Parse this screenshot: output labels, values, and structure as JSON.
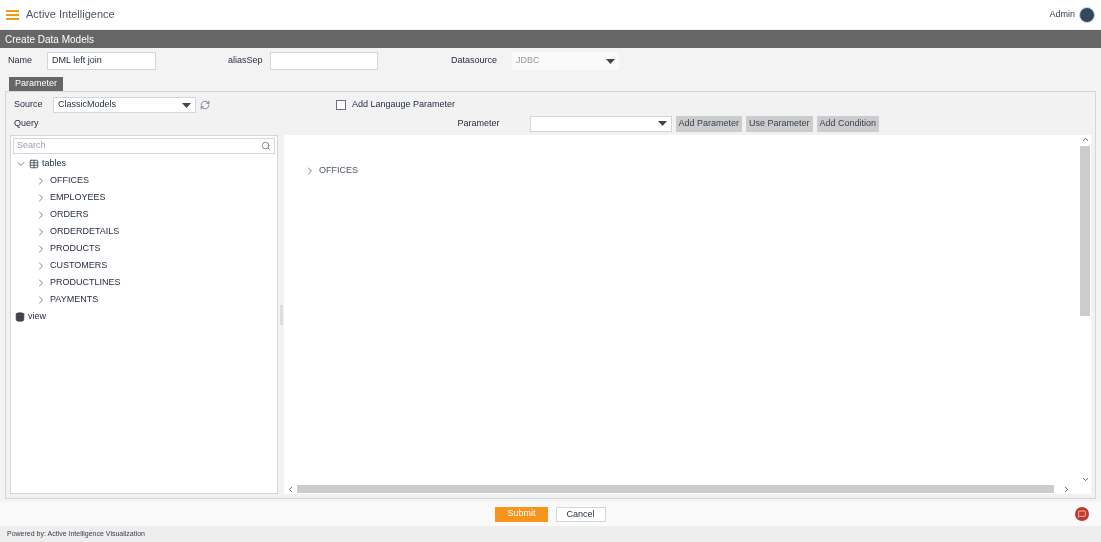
{
  "header": {
    "app_name": "Active Intelligence",
    "user": "Admin"
  },
  "page_title": "Create Data Models",
  "form": {
    "name_label": "Name",
    "name_value": "DML left join",
    "alias_label": "aliasSep",
    "datasource_label": "Datasource",
    "datasource_value": "JDBC",
    "datasource_disabled": true
  },
  "tabs": [
    {
      "label": "Parameter",
      "selected": true
    }
  ],
  "source": {
    "label": "Source",
    "value": "ClassicModels"
  },
  "language_param": {
    "label": "Add Langauge Parameter",
    "checked": false
  },
  "query_label": "Query",
  "parameter": {
    "label": "Parameter",
    "buttons": [
      "Add Parameter",
      "Use Parameter",
      "Add Condition"
    ]
  },
  "tree_search": {
    "placeholder": "Search"
  },
  "tree": [
    {
      "kind": "tables",
      "label": "tables",
      "expanded": true,
      "children": [
        {
          "label": "OFFICES",
          "expanded": false
        },
        {
          "label": "EMPLOYEES",
          "expanded": false
        },
        {
          "label": "ORDERS",
          "expanded": false
        },
        {
          "label": "ORDERDETAILS",
          "expanded": false
        },
        {
          "label": "PRODUCTS",
          "expanded": false
        },
        {
          "label": "CUSTOMERS",
          "expanded": false
        },
        {
          "label": "PRODUCTLINES",
          "expanded": false
        },
        {
          "label": "PAYMENTS",
          "expanded": false
        }
      ]
    },
    {
      "kind": "view",
      "label": "view"
    }
  ],
  "canvas_items": [
    {
      "label": "OFFICES",
      "expanded": false
    }
  ],
  "actions": {
    "submit": "Submit",
    "cancel": "Cancel"
  },
  "footer": "Powered by: Active Intelligence Visualization"
}
